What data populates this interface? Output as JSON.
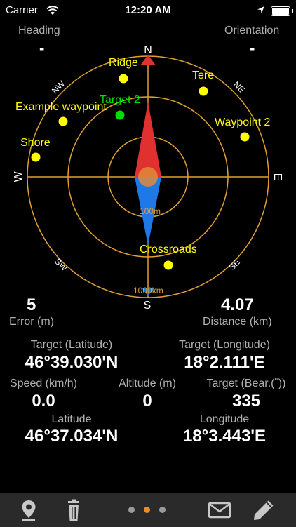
{
  "status": {
    "carrier": "Carrier",
    "time": "12:20 AM"
  },
  "header": {
    "heading_label": "Heading",
    "heading_value": "-",
    "orientation_label": "Orientation",
    "orientation_value": "-"
  },
  "compass": {
    "cardinals": {
      "n": "N",
      "e": "E",
      "s": "S",
      "w": "W"
    },
    "intercardinals": {
      "nw": "NW",
      "ne": "NE",
      "sw": "SW",
      "se": "SE"
    },
    "ring_inner_label": "100m",
    "ring_outer_label": "1000km",
    "waypoints": [
      {
        "label": "Ridge"
      },
      {
        "label": "Tere"
      },
      {
        "label": "Target 2"
      },
      {
        "label": "Example waypoint"
      },
      {
        "label": "Waypoint 2"
      },
      {
        "label": "Shore"
      },
      {
        "label": "Crossroads"
      }
    ],
    "colors": {
      "ring": "#e0a030",
      "waypoint": "#ffff00",
      "target": "#00dd00",
      "needle_north": "#e03030",
      "needle_south": "#1e78e6"
    }
  },
  "metrics": {
    "error_value": "5",
    "error_label": "Error (m)",
    "distance_value": "4.07",
    "distance_label": "Distance (km)",
    "target_lat_label": "Target (Latitude)",
    "target_lat_value": "46°39.030'N",
    "target_lon_label": "Target (Longitude)",
    "target_lon_value": "18°2.111'E",
    "speed_label": "Speed (km/h)",
    "speed_value": "0.0",
    "altitude_label": "Altitude (m)",
    "altitude_value": "0",
    "bearing_label": "Target (Bear.(˚))",
    "bearing_value": "335",
    "lat_label": "Latitude",
    "lat_value": "46°37.034'N",
    "lon_label": "Longitude",
    "lon_value": "18°3.443'E"
  },
  "toolbar": {
    "icons": [
      "location-pin-icon",
      "trash-icon",
      "mail-icon",
      "pencil-icon"
    ],
    "page_count": 3,
    "active_page": 2
  }
}
